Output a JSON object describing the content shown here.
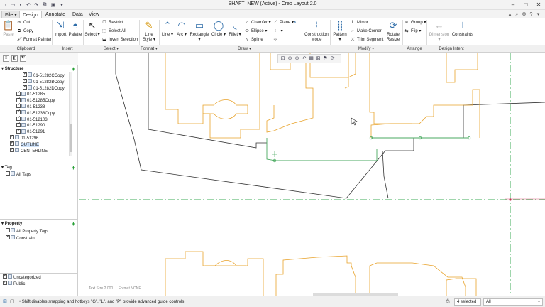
{
  "window": {
    "title": "SHAFT_NEW (Active) - Creo Layout 2.0",
    "controls": {
      "minimize": "–",
      "maximize": "□",
      "close": "✕"
    }
  },
  "quick_access": [
    "new-icon",
    "open-icon",
    "save-icon",
    "undo-icon",
    "redo-icon",
    "window-icon",
    "close-window-icon",
    "customize-icon"
  ],
  "tabs": [
    {
      "label": "File",
      "active": false,
      "kind": "file"
    },
    {
      "label": "Design",
      "active": true
    },
    {
      "label": "Annotate",
      "active": false
    },
    {
      "label": "Data",
      "active": false
    },
    {
      "label": "View",
      "active": false
    }
  ],
  "ribbon": {
    "clipboard": {
      "paste": "Paste",
      "cut": "Cut",
      "copy": "Copy",
      "format_painter": "Format Painter"
    },
    "insert": {
      "import": "Import",
      "palette": "Palette"
    },
    "select": {
      "select": "Select",
      "restrict": "Restrict",
      "select_all": "Select All",
      "invert_selection": "Invert Selection"
    },
    "format": {
      "line_style": "Line Style"
    },
    "draw": {
      "line": "Line",
      "arc": "Arc",
      "rectangle": "Rectangle",
      "circle": "Circle",
      "fillet": "Fillet",
      "chamfer": "Chamfer",
      "plane": "Plane",
      "ellipse": "Ellipse",
      "spline": "Spline"
    },
    "construction": {
      "mode": "Construction Mode"
    },
    "modify": {
      "pattern": "Pattern",
      "mirror": "Mirror",
      "make_corner": "Make Corner",
      "trim_segment": "Trim Segment",
      "rotate_resize": "Rotate Resize"
    },
    "arrange": {
      "group": "Group",
      "flip": "Flip"
    },
    "design_intent": {
      "dimension": "Dimension",
      "constraints": "Constraints"
    }
  },
  "groups": [
    "Clipboard",
    "Insert",
    "Select",
    "Format",
    "Draw",
    "Modify",
    "Arrange",
    "Design Intent"
  ],
  "structure": {
    "title": "Structure",
    "items": [
      {
        "label": "01-51282CCopy",
        "checked": true,
        "indent": 2
      },
      {
        "label": "01-51282BCopy",
        "checked": true,
        "indent": 2
      },
      {
        "label": "01-51282DCopy",
        "checked": true,
        "indent": 2
      },
      {
        "label": "01-51285",
        "checked": true,
        "indent": 1
      },
      {
        "label": "01-51285Copy",
        "checked": true,
        "indent": 1
      },
      {
        "label": "01-51238",
        "checked": true,
        "indent": 1
      },
      {
        "label": "01-51238Copy",
        "checked": true,
        "indent": 1
      },
      {
        "label": "01-512103",
        "checked": true,
        "indent": 1
      },
      {
        "label": "01-51290",
        "checked": true,
        "indent": 1
      },
      {
        "label": "01-51291",
        "checked": true,
        "indent": 1
      },
      {
        "label": "01-51296",
        "checked": true,
        "indent": 0
      },
      {
        "label": "OUTLINE",
        "checked": true,
        "indent": 0,
        "selected": true
      },
      {
        "label": "CENTERLINE",
        "checked": true,
        "indent": 0
      }
    ]
  },
  "tag": {
    "title": "Tag",
    "items": [
      {
        "label": "All Tags"
      }
    ]
  },
  "property": {
    "title": "Property",
    "items": [
      {
        "label": "All Property Tags",
        "checked": false
      },
      {
        "label": "Constraint",
        "checked": true
      }
    ]
  },
  "layers": [
    {
      "label": "Uncategorized",
      "checked": true
    },
    {
      "label": "Public",
      "checked": true
    }
  ],
  "canvas": {
    "text_size": "Text Size 2.000",
    "format": "Format NONE"
  },
  "status": {
    "message": "Shift disables snapping and hotkeys \"G\", \"L\", and \"P\" provide advanced guide controls",
    "selected": "4 selected",
    "filter": "All"
  },
  "colors": {
    "geometry_orange": "#e8a22a",
    "geometry_green": "#4aaa60",
    "outline_dark": "#333333",
    "centerline_green": "#3fae5a",
    "accent_blue": "#2d6ca8"
  }
}
